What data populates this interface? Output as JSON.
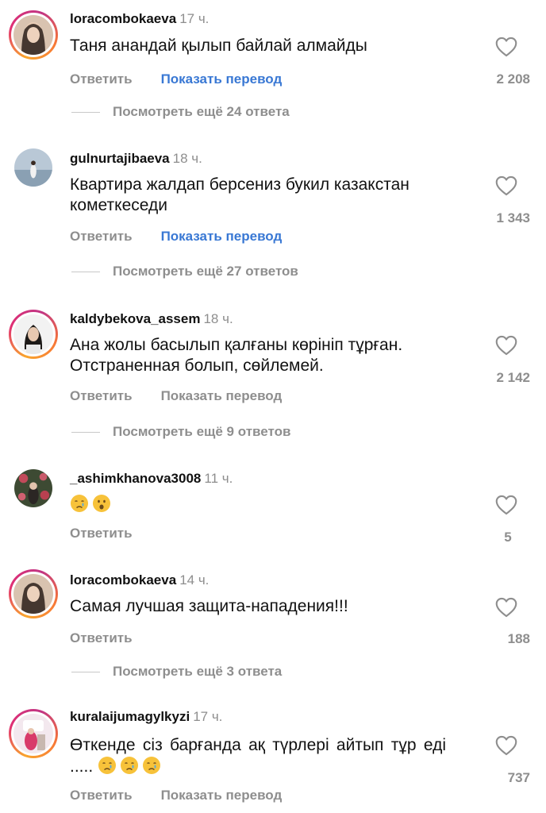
{
  "colors": {
    "link_blue": "#3978d4",
    "muted": "#8e8e8e",
    "text": "#111111"
  },
  "comments": [
    {
      "username": "loracombokaeva",
      "time": "17 ч.",
      "text": "Таня анандай қылып байлай алмайды",
      "reply": "Ответить",
      "translate": "Показать перевод",
      "likes": "2 208",
      "view_replies": "Посмотреть ещё 24 ответа"
    },
    {
      "username": "gulnurtajibaeva",
      "time": "18 ч.",
      "text": "Квартира жалдап берсениз букил казакстан кометкеседи",
      "reply": "Ответить",
      "translate": "Показать перевод",
      "likes": "1 343",
      "view_replies": "Посмотреть ещё 27 ответов"
    },
    {
      "username": "kaldybekova_assem",
      "time": "18 ч.",
      "text": "Ана жолы басылып қалғаны көрініп тұрған. Отстраненная болып, сөйлемей.",
      "reply": "Ответить",
      "translate": "Показать перевод",
      "likes": "2 142",
      "view_replies": "Посмотреть ещё 9 ответов"
    },
    {
      "username": "_ashimkhanova3008",
      "time": "11 ч.",
      "text": "",
      "emojis": [
        "crying-face-icon",
        "surprised-face-icon"
      ],
      "reply": "Ответить",
      "likes": "5"
    },
    {
      "username": "loracombokaeva",
      "time": "14 ч.",
      "text": "Самая лучшая защита-нападения!!!",
      "reply": "Ответить",
      "likes": "188",
      "view_replies": "Посмотреть ещё 3 ответа"
    },
    {
      "username": "kuralaijumagylkyzi",
      "time": "17 ч.",
      "text": "Өткенде сіз барғанда ақ түрлері айтып тұр еді .....",
      "emojis": [
        "crying-face-icon",
        "crying-face-icon",
        "crying-face-icon"
      ],
      "reply": "Ответить",
      "translate": "Показать перевод",
      "likes": "737"
    }
  ]
}
